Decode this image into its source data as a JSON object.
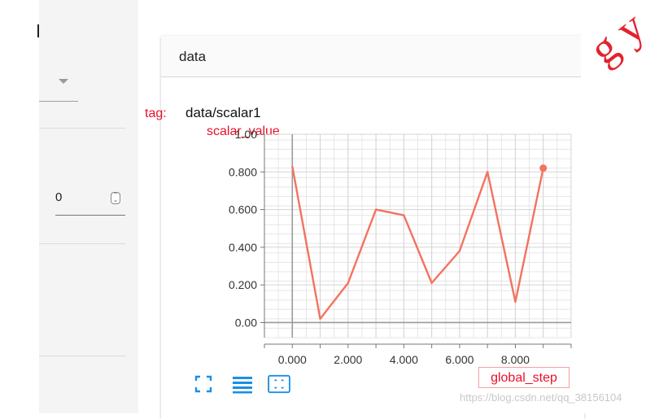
{
  "sidebar": {
    "number_input": {
      "value": "0"
    }
  },
  "card": {
    "title": "data",
    "tag_label": "tag:",
    "tag_value": "data/scalar1",
    "y_axis_title": "scalar_value",
    "x_axis_title": "global_step"
  },
  "toolbar": {
    "fit_icon": "expand-corners-icon",
    "data_table_icon": "list-lines-icon",
    "fit_domain_icon": "fit-domain-icon"
  },
  "watermark_text": "https://blog.csdn.net/qq_38156104",
  "overlay_text": "g y",
  "colors": {
    "series": "#f4725f",
    "annotation_red": "#e8102a",
    "toolbar_blue": "#1a8fe6"
  },
  "chart_data": {
    "type": "line",
    "x_tick_labels": [
      "0.000",
      "2.000",
      "4.000",
      "6.000",
      "8.000"
    ],
    "y_tick_labels": [
      "0.00",
      "0.200",
      "0.400",
      "0.600",
      "0.800",
      "1.00"
    ],
    "xlim": [
      -1,
      10
    ],
    "ylim": [
      -0.08,
      1.0
    ],
    "grid": true,
    "series": [
      {
        "x": [
          0,
          1,
          2,
          3,
          4,
          5,
          6,
          7,
          8,
          9
        ],
        "y": [
          0.83,
          0.02,
          0.21,
          0.6,
          0.57,
          0.21,
          0.38,
          0.8,
          0.11,
          0.82
        ]
      }
    ]
  }
}
